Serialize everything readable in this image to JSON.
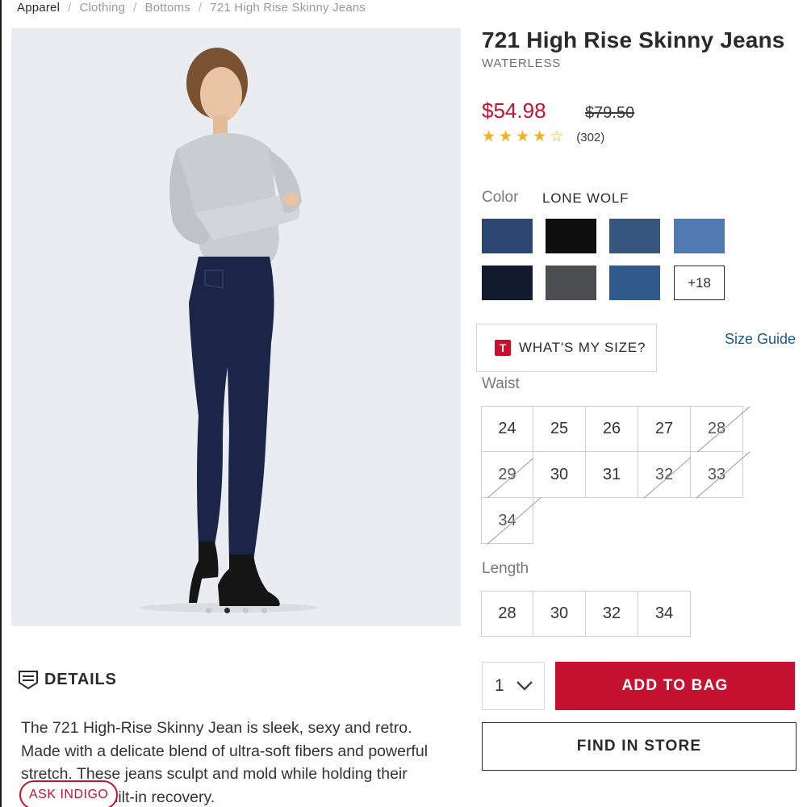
{
  "breadcrumb": [
    "Apparel",
    "Clothing",
    "Bottoms",
    "721 High Rise Skinny Jeans"
  ],
  "product": {
    "title": "721 High Rise Skinny Jeans",
    "subtitle": "WATERLESS",
    "sale_price": "$54.98",
    "original_price": "$79.50",
    "rating": 4,
    "rating_max": 5,
    "review_count": "(302)"
  },
  "carousel": {
    "count": 4,
    "active_index": 1
  },
  "color": {
    "label": "Color",
    "selected": "LONE WOLF",
    "swatches": [
      {
        "name": "swatch-1",
        "color": "#2b4670"
      },
      {
        "name": "swatch-2",
        "color": "#0f0f10"
      },
      {
        "name": "swatch-3",
        "color": "#35577e"
      },
      {
        "name": "swatch-4",
        "color": "#4f79b1"
      },
      {
        "name": "swatch-5",
        "color": "#121a2e"
      },
      {
        "name": "swatch-6",
        "color": "#4c4d50"
      },
      {
        "name": "swatch-7",
        "color": "#2f5a8c"
      }
    ],
    "more_label": "+18"
  },
  "size": {
    "whats_my_size_icon": "T",
    "whats_my_size_label": "WHAT'S MY SIZE?",
    "size_guide_label": "Size Guide",
    "waist_label": "Waist",
    "waist": [
      {
        "label": "24",
        "available": true
      },
      {
        "label": "25",
        "available": true
      },
      {
        "label": "26",
        "available": true
      },
      {
        "label": "27",
        "available": true
      },
      {
        "label": "28",
        "available": false
      },
      {
        "label": "29",
        "available": false
      },
      {
        "label": "30",
        "available": true
      },
      {
        "label": "31",
        "available": true
      },
      {
        "label": "32",
        "available": false
      },
      {
        "label": "33",
        "available": false
      },
      {
        "label": "34",
        "available": false
      }
    ],
    "length_label": "Length",
    "length": [
      {
        "label": "28",
        "available": true
      },
      {
        "label": "30",
        "available": true
      },
      {
        "label": "32",
        "available": true
      },
      {
        "label": "34",
        "available": true
      }
    ]
  },
  "purchase": {
    "quantity": "1",
    "add_to_bag_label": "ADD TO BAG",
    "find_in_store_label": "FIND IN STORE"
  },
  "details": {
    "title": "DETAILS",
    "text": "The 721 High-Rise Skinny Jean is sleek, sexy and retro. Made with a delicate blend of ultra-soft fibers and powerful stretch. These jeans sculpt and mold while holding their shape with built-in recovery."
  },
  "chat": {
    "label": "ASK INDIGO"
  },
  "colors": {
    "accent": "#c41230",
    "star": "#f2b01e",
    "link": "#1a5b8c"
  }
}
